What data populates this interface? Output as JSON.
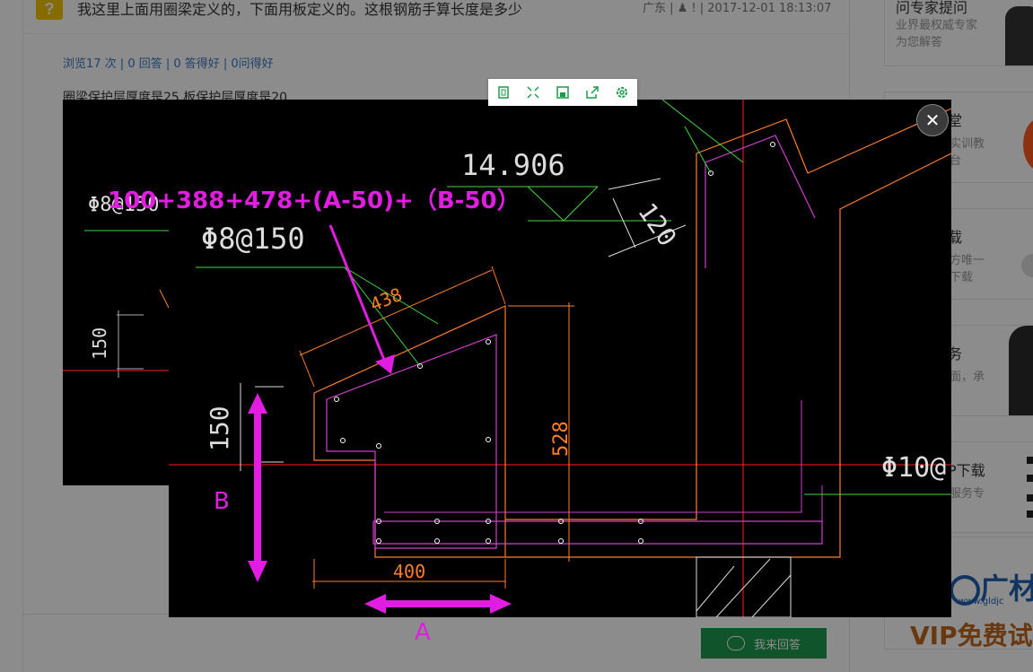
{
  "question": {
    "icon_glyph": "?",
    "title": "我这里上面用圈梁定义的，下面用板定义的。这根钢筋手算长度是多少",
    "meta": "广东 | ♟ ! | 2017-12-01 18:13:07",
    "stats": "浏览17 次 | 0 回答 | 0 答得好 | 0问得好",
    "description": "圈梁保护层厚度是25 板保护层厚度是20",
    "answer_button": "我来回答"
  },
  "sidebar": {
    "cards": [
      {
        "title": "问专家提问",
        "sub": "业界最权威专家\n为您解答"
      },
      {
        "title": "堂",
        "sub": "实训教\n台"
      },
      {
        "title": "载",
        "sub": "方唯一\n下载"
      },
      {
        "title": "务",
        "sub": "面，承"
      },
      {
        "title": "P下载",
        "sub": "服务专"
      }
    ],
    "brand": "广材",
    "brand_url": "www.gldjc",
    "vip": "VIP免费试"
  },
  "viewer": {
    "toolbar": [
      "fit-icon",
      "fullscreen-icon",
      "save-icon",
      "share-icon",
      "settings-icon"
    ],
    "close_glyph": "✕"
  },
  "drawing": {
    "formula": "100+388+478+(A-50)+（B-50）",
    "rebar_left": "Φ8@150",
    "rebar_right": "Φ10@",
    "elevation": "14.906",
    "dim_120": "120",
    "dim_438": "438",
    "dim_528": "528",
    "dim_400": "400",
    "dim_150": "150",
    "small_dim_150": "150",
    "small_rebar": "Φ8@150"
  },
  "annotations": {
    "label_a": "A",
    "label_b": "B"
  },
  "colors": {
    "magenta": "#e21de2",
    "green": "#1d9a4e",
    "link_blue": "#3a78c3",
    "cad_orange": "#ff7f27",
    "cad_green": "#3fd93f",
    "cad_red": "#ff2020"
  }
}
